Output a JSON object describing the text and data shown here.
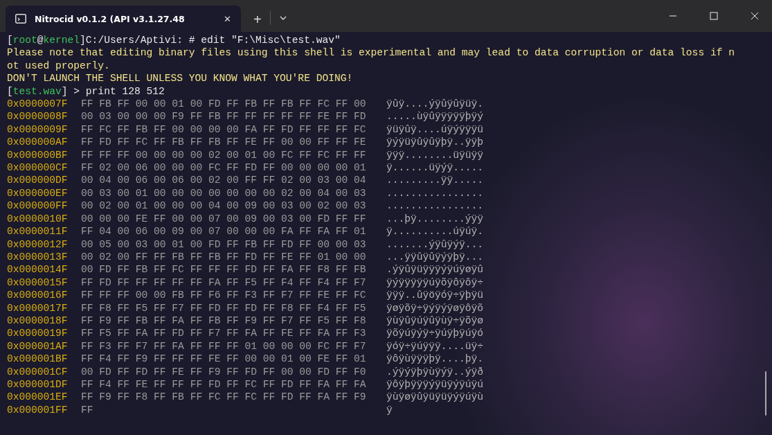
{
  "window": {
    "tab_title": "Nitrocid v0.1.2 (API v3.1.27.48",
    "tab_close": "✕",
    "new_tab": "+"
  },
  "terminal": {
    "prompt": [
      {
        "text": "[",
        "kind": "plain"
      },
      {
        "text": "root",
        "kind": "accent"
      },
      {
        "text": "@",
        "kind": "plain"
      },
      {
        "text": "kernel",
        "kind": "accent"
      },
      {
        "text": "]C:/Users/Aptivi: # edit \"F:\\Misc\\test.wav\"",
        "kind": "plain"
      }
    ],
    "warning_lines": [
      "Please note that editing binary files using this shell is experimental and may lead to data corruption or data loss if n",
      "ot used properly.",
      "DON'T LAUNCH THE SHELL UNLESS YOU KNOW WHAT YOU'RE DOING!"
    ],
    "sub_prompt": [
      {
        "text": "[",
        "kind": "plain"
      },
      {
        "text": "test.wav",
        "kind": "accent"
      },
      {
        "text": "] > print 128 512",
        "kind": "plain"
      }
    ],
    "dump": [
      {
        "address": "0x0000007F",
        "hex": "FF FB FF 00 00 01 00 FD FF FB FF FB FF FC FF 00",
        "ascii": "ÿûÿ....ýÿûÿûÿüÿ."
      },
      {
        "address": "0x0000008F",
        "hex": "00 03 00 00 00 F9 FF FB FF FF FF FF FF FE FF FD",
        "ascii": ".....ùÿûÿÿÿÿÿþÿý"
      },
      {
        "address": "0x0000009F",
        "hex": "FF FC FF FB FF 00 00 00 00 FA FF FD FF FF FF FC",
        "ascii": "ÿüÿûÿ....úÿýÿÿÿü"
      },
      {
        "address": "0x000000AF",
        "hex": "FF FD FF FC FF FB FF FB FF FE FF 00 00 FF FF FE",
        "ascii": "ÿýÿüÿûÿûÿþÿ..ÿÿþ"
      },
      {
        "address": "0x000000BF",
        "hex": "FF FF FF 00 00 00 00 02 00 01 00 FC FF FC FF FF",
        "ascii": "ÿÿÿ........üÿüÿÿ"
      },
      {
        "address": "0x000000CF",
        "hex": "FF 02 00 06 00 00 00 FC FF FD FF 00 00 00 00 01",
        "ascii": "ÿ......üÿýÿ....."
      },
      {
        "address": "0x000000DF",
        "hex": "00 04 00 06 00 06 00 02 00 FF FF 02 00 03 00 04",
        "ascii": ".........ÿÿ....."
      },
      {
        "address": "0x000000EF",
        "hex": "00 03 00 01 00 00 00 00 00 00 00 02 00 04 00 03",
        "ascii": "................"
      },
      {
        "address": "0x000000FF",
        "hex": "00 02 00 01 00 00 00 04 00 09 00 03 00 02 00 03",
        "ascii": "................"
      },
      {
        "address": "0x0000010F",
        "hex": "00 00 00 FE FF 00 00 07 00 09 00 03 00 FD FF FF",
        "ascii": "...þÿ........ýÿÿ"
      },
      {
        "address": "0x0000011F",
        "hex": "FF 04 00 06 00 09 00 07 00 00 00 FA FF FA FF 01",
        "ascii": "ÿ..........úÿúÿ."
      },
      {
        "address": "0x0000012F",
        "hex": "00 05 00 03 00 01 00 FD FF FB FF FD FF 00 00 03",
        "ascii": ".......ýÿûÿýÿ..."
      },
      {
        "address": "0x0000013F",
        "hex": "00 02 00 FF FF FB FF FB FF FD FF FE FF 01 00 00",
        "ascii": "...ÿÿûÿûÿýÿþÿ..."
      },
      {
        "address": "0x0000014F",
        "hex": "00 FD FF FB FF FC FF FF FF FD FF FA FF F8 FF FB",
        "ascii": ".ýÿûÿüÿÿÿýÿúÿøÿû"
      },
      {
        "address": "0x0000015F",
        "hex": "FF FD FF FF FF FF FF FA FF F5 FF F4 FF F4 FF F7",
        "ascii": "ÿýÿÿÿÿÿúÿõÿôÿôÿ÷"
      },
      {
        "address": "0x0000016F",
        "hex": "FF FF FF 00 00 FB FF F6 FF F3 FF F7 FF FE FF FC",
        "ascii": "ÿÿÿ..ûÿöÿóÿ÷ÿþÿü"
      },
      {
        "address": "0x0000017F",
        "hex": "FF F8 FF F5 FF F7 FF FD FF FD FF F8 FF F4 FF F5",
        "ascii": "ÿøÿõÿ÷ÿýÿýÿøÿôÿõ"
      },
      {
        "address": "0x0000018F",
        "hex": "FF F9 FF FB FF FA FF FB FF F9 FF F7 FF F5 FF F8",
        "ascii": "ÿùÿûÿúÿûÿùÿ÷ÿõÿø"
      },
      {
        "address": "0x0000019F",
        "hex": "FF F5 FF FA FF FD FF F7 FF FA FF FE FF FA FF F3",
        "ascii": "ÿõÿúÿýÿ÷ÿúÿþÿúÿó"
      },
      {
        "address": "0x000001AF",
        "hex": "FF F3 FF F7 FF FA FF FF FF 01 00 00 00 FC FF F7",
        "ascii": "ÿóÿ÷ÿúÿÿÿ....üÿ÷"
      },
      {
        "address": "0x000001BF",
        "hex": "FF F4 FF F9 FF FF FF FE FF 00 00 01 00 FE FF 01",
        "ascii": "ÿôÿùÿÿÿþÿ....þÿ."
      },
      {
        "address": "0x000001CF",
        "hex": "00 FD FF FD FF FE FF F9 FF FD FF 00 00 FD FF F0",
        "ascii": ".ýÿýÿþÿùÿýÿ..ýÿð"
      },
      {
        "address": "0x000001DF",
        "hex": "FF F4 FF FE FF FF FF FD FF FC FF FD FF FA FF FA",
        "ascii": "ÿôÿþÿÿÿýÿüÿýÿúÿú"
      },
      {
        "address": "0x000001EF",
        "hex": "FF F9 FF F8 FF FB FF FC FF FC FF FD FF FA FF F9",
        "ascii": "ÿùÿøÿûÿüÿüÿýÿúÿù"
      },
      {
        "address": "0x000001FF",
        "hex": "FF",
        "ascii": "ÿ"
      }
    ]
  }
}
